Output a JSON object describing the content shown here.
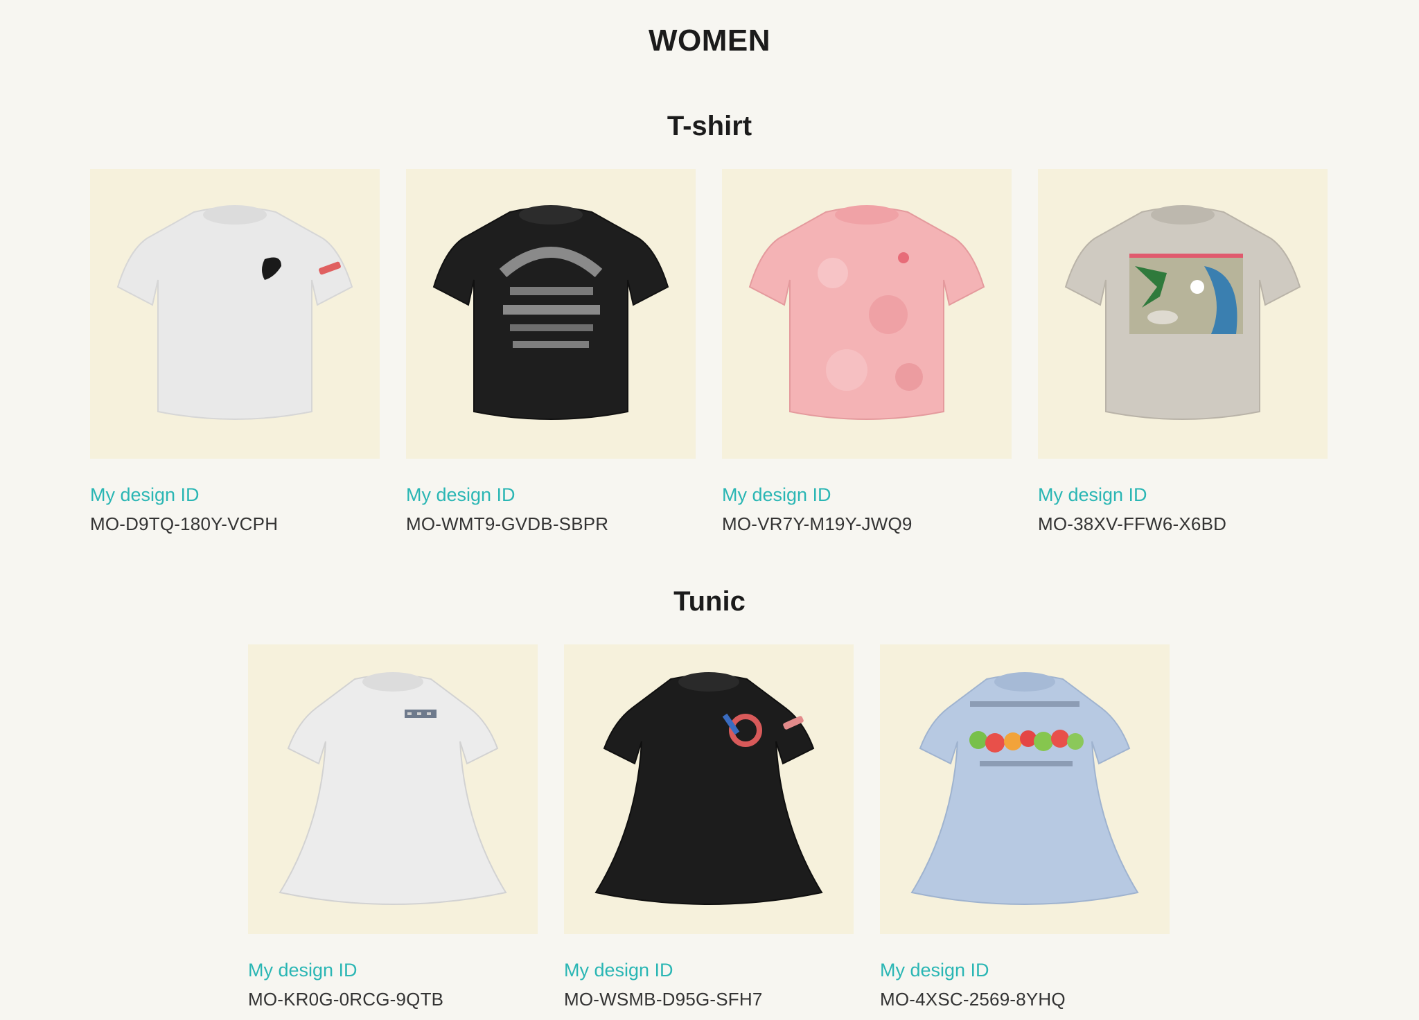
{
  "page": {
    "title": "WOMEN"
  },
  "sections": [
    {
      "title": "T-shirt",
      "items": [
        {
          "label": "My design ID",
          "id": "MO-D9TQ-180Y-VCPH",
          "shirt_color": "#e9e9e9",
          "icon": "white-tshirt-image"
        },
        {
          "label": "My design ID",
          "id": "MO-WMT9-GVDB-SBPR",
          "shirt_color": "#1e1e1e",
          "icon": "black-tshirt-image"
        },
        {
          "label": "My design ID",
          "id": "MO-VR7Y-M19Y-JWQ9",
          "shirt_color": "#f4b3b5",
          "icon": "pink-tshirt-image"
        },
        {
          "label": "My design ID",
          "id": "MO-38XV-FFW6-X6BD",
          "shirt_color": "#cfcac1",
          "icon": "beige-tshirt-image"
        }
      ]
    },
    {
      "title": "Tunic",
      "items": [
        {
          "label": "My design ID",
          "id": "MO-KR0G-0RCG-9QTB",
          "shirt_color": "#ececec",
          "icon": "white-tunic-image"
        },
        {
          "label": "My design ID",
          "id": "MO-WSMB-D95G-SFH7",
          "shirt_color": "#1c1c1c",
          "icon": "black-tunic-image"
        },
        {
          "label": "My design ID",
          "id": "MO-4XSC-2569-8YHQ",
          "shirt_color": "#b7c9e2",
          "icon": "lightblue-tunic-image"
        }
      ]
    }
  ],
  "colors": {
    "background": "#f7f6f1",
    "thumb_background": "#f6f1dc",
    "accent": "#2ab6b4"
  }
}
